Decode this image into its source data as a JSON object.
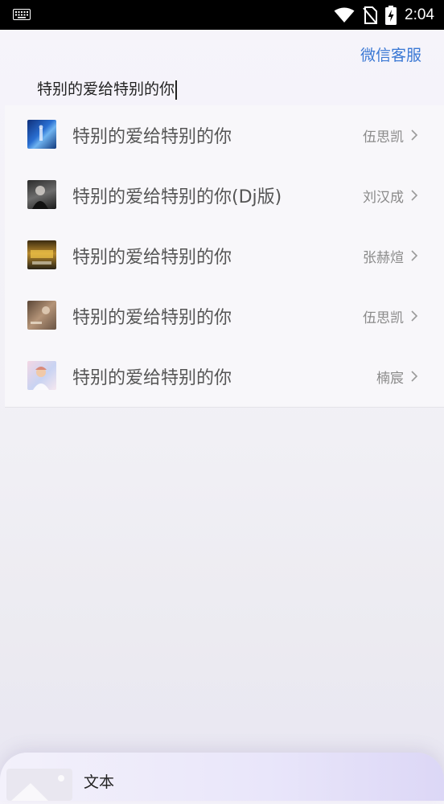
{
  "status_bar": {
    "time": "2:04"
  },
  "header": {
    "service_link": "微信客服"
  },
  "search": {
    "query": "特别的爱给特别的你"
  },
  "results": [
    {
      "title": "特别的爱给特别的你",
      "artist": "伍思凯"
    },
    {
      "title": "特别的爱给特别的你(Dj版)",
      "artist": "刘汉成"
    },
    {
      "title": "特别的爱给特别的你",
      "artist": "张赫煊"
    },
    {
      "title": "特别的爱给特别的你",
      "artist": "伍思凯"
    },
    {
      "title": "特别的爱给特别的你",
      "artist": "楠宸"
    }
  ],
  "player": {
    "label": "文本"
  }
}
